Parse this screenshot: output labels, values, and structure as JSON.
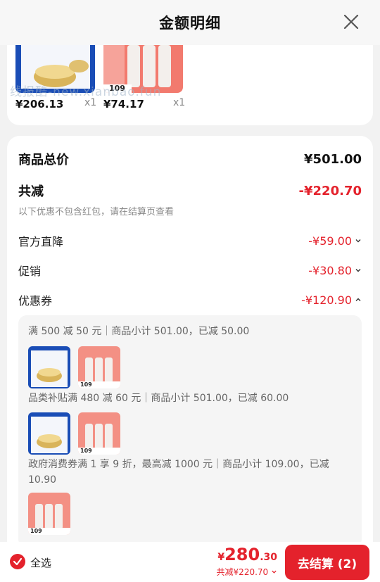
{
  "header": {
    "title": "金额明细"
  },
  "top_products": [
    {
      "price": "¥206.13",
      "qty": "x1"
    },
    {
      "price": "¥74.17",
      "qty": "x1",
      "thumb_badge": "109"
    }
  ],
  "watermark": "线报酷-new.xianbao.fun",
  "summary": {
    "goods_total_label": "商品总价",
    "goods_total_value": "¥501.00",
    "reduce_label": "共减",
    "reduce_value": "-¥220.70",
    "note": "以下优惠不包含红包，请在结算页查看",
    "items": [
      {
        "label": "官方直降",
        "value": "-¥59.00"
      },
      {
        "label": "促销",
        "value": "-¥30.80"
      },
      {
        "label": "优惠券",
        "value": "-¥120.90"
      }
    ]
  },
  "coupons": [
    {
      "text": "满 500 减 50 元｜商品小计 501.00，已减 50.00"
    },
    {
      "text": "品类补贴满 480 减 60 元｜商品小计 501.00，已减 60.00"
    },
    {
      "text": "政府消费券满 1 享 9 折，最高减 1000 元｜商品小计 109.00，已减 10.90"
    }
  ],
  "mini_badge": "109",
  "bottom": {
    "select_all": "全选",
    "price_symbol": "¥",
    "price_int": "280",
    "price_dec": ".30",
    "saved": "共减¥220.70",
    "checkout": "去结算 (2)"
  },
  "colors": {
    "accent": "#e4222c"
  },
  "icons": {
    "close": "close-icon",
    "check": "check-icon",
    "chevron-down": "chevron-down-icon",
    "chevron-up": "chevron-up-icon"
  }
}
